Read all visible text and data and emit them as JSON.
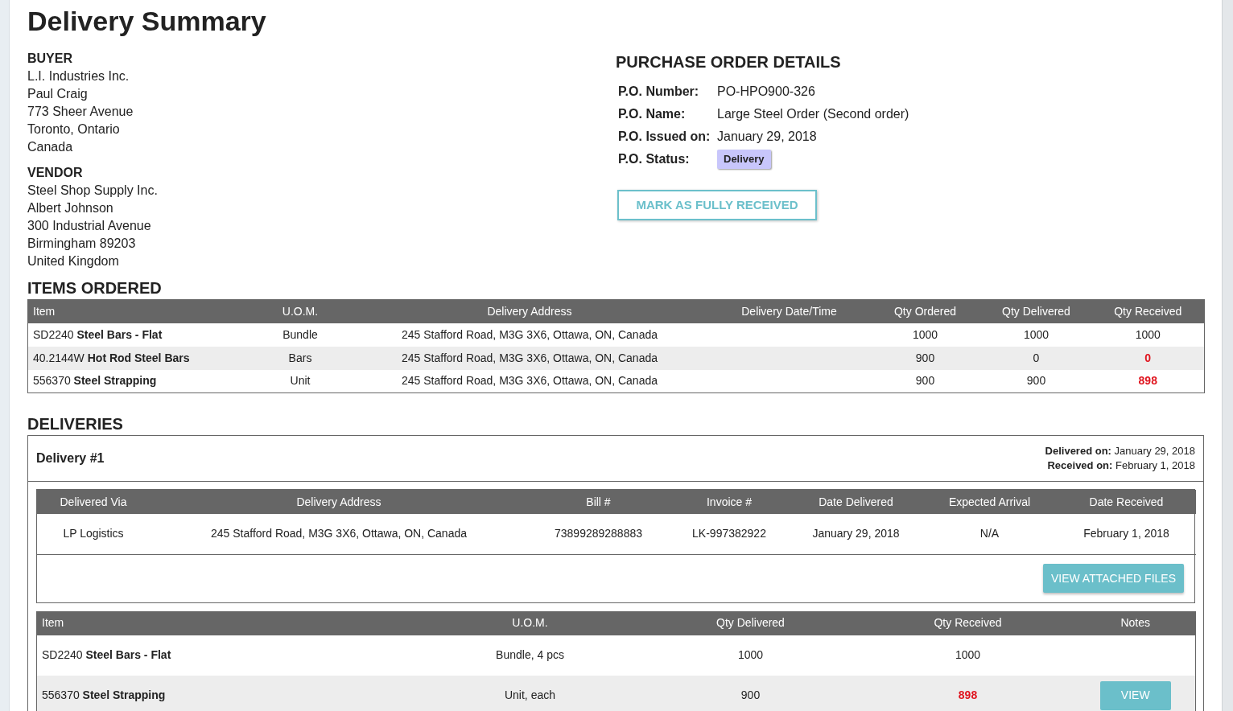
{
  "title": "Delivery Summary",
  "buyer": {
    "heading": "BUYER",
    "lines": [
      "L.I. Industries Inc.",
      "Paul Craig",
      "773 Sheer Avenue",
      "Toronto, Ontario",
      "Canada"
    ]
  },
  "vendor": {
    "heading": "VENDOR",
    "lines": [
      "Steel Shop Supply Inc.",
      "Albert Johnson",
      "300 Industrial Avenue",
      "Birmingham 89203",
      "United Kingdom"
    ]
  },
  "purchase_order": {
    "heading": "PURCHASE ORDER DETAILS",
    "fields": [
      {
        "label": "P.O. Number:",
        "value": "PO-HPO900-326",
        "kind": "text"
      },
      {
        "label": "P.O. Name:",
        "value": "Large Steel Order (Second order)",
        "kind": "text"
      },
      {
        "label": "P.O. Issued on:",
        "value": "January 29, 2018",
        "kind": "text"
      },
      {
        "label": "P.O. Status:",
        "value": "Delivery",
        "kind": "badge"
      }
    ],
    "button": "MARK AS FULLY RECEIVED"
  },
  "items_ordered": {
    "heading": "ITEMS ORDERED",
    "columns": [
      "Item",
      "U.O.M.",
      "Delivery Address",
      "Delivery Date/Time",
      "Qty Ordered",
      "Qty Delivered",
      "Qty Received"
    ],
    "rows": [
      {
        "item": "SD2240 **Steel Bars - Flat**",
        "uom": "Bundle",
        "address": "245 Stafford Road, M3G 3X6, Ottawa, ON, Canada",
        "qty_ordered": "1000",
        "qty_delivered": "1000",
        "qty_received": "1000",
        "short": false
      },
      {
        "item": "40.2144W **Hot Rod Steel Bars**",
        "uom": "Bars",
        "address": "245 Stafford Road, M3G 3X6, Ottawa, ON, Canada",
        "qty_ordered": "900",
        "qty_delivered": "0",
        "qty_received": "0",
        "short": true
      },
      {
        "item": "556370 **Steel Strapping**",
        "uom": "Unit",
        "address": "245 Stafford Road, M3G 3X6, Ottawa, ON, Canada",
        "qty_ordered": "900",
        "qty_delivered": "900",
        "qty_received": "898",
        "short": true
      }
    ]
  },
  "deliveries": {
    "heading": "DELIVERIES",
    "list": [
      {
        "title": "Delivery #1",
        "delivered_on": "**Delivered on:** January 29, 2018",
        "received_on": "**Received on:** February 1, 2018",
        "columns": [
          "Delivered Via",
          "Delivery Address",
          "Bill #",
          "Invoice #",
          "Date Delivered",
          "Expected Arrival",
          "Date Received"
        ],
        "row": [
          "LP Logistics",
          "245 Stafford Road, M3G 3X6, Ottawa, ON, Canada",
          "73899289288883",
          "LK-997382922",
          "January 29, 2018",
          "N/A",
          "February 1, 2018"
        ],
        "files_button": "VIEW ATTACHED FILES",
        "item_columns": [
          "Item",
          "U.O.M.",
          "Qty Delivered",
          "Qty Received",
          "Notes"
        ],
        "items": [
          {
            "item": "SD2240 **Steel Bars - Flat**",
            "uom": "Bundle, 4 pcs",
            "qty_delivered": "1000",
            "qty_received": "1000",
            "short": false
          },
          {
            "item": "556370 **Steel Strapping**",
            "uom": "Unit, each",
            "qty_delivered": "900",
            "qty_received": "898",
            "short": true,
            "notes_button": "VIEW"
          }
        ]
      }
    ]
  }
}
